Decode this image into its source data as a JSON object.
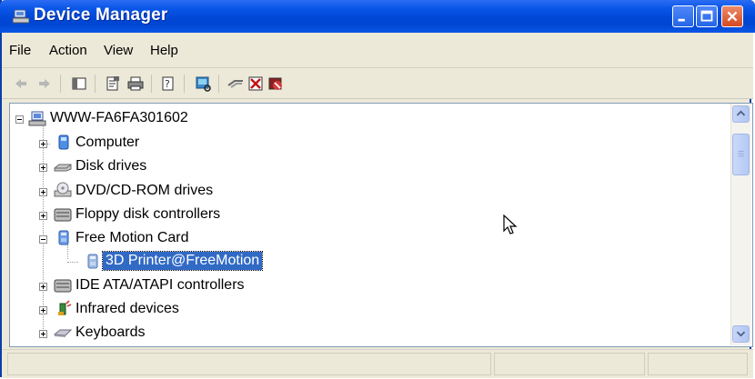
{
  "window": {
    "title": "Device Manager"
  },
  "menu": [
    "File",
    "Action",
    "View",
    "Help"
  ],
  "toolbar_icons": [
    "back-icon",
    "forward-icon",
    "console-tree-icon",
    "properties-icon",
    "print-icon",
    "help-icon",
    "scan-hardware-icon",
    "update-driver-icon",
    "uninstall-icon",
    "disable-icon"
  ],
  "tree": {
    "root": "WWW-FA6FA301602",
    "items": [
      {
        "label": "Computer",
        "icon": "computer-icon",
        "expanded": false
      },
      {
        "label": "Disk drives",
        "icon": "disk-drive-icon",
        "expanded": false
      },
      {
        "label": "DVD/CD-ROM drives",
        "icon": "dvd-drive-icon",
        "expanded": false
      },
      {
        "label": "Floppy disk controllers",
        "icon": "floppy-controller-icon",
        "expanded": false
      },
      {
        "label": "Free Motion Card",
        "icon": "device-icon",
        "expanded": true
      },
      {
        "label": "3D Printer@FreeMotion",
        "icon": "device-icon",
        "child": true,
        "selected": true
      },
      {
        "label": "IDE ATA/ATAPI controllers",
        "icon": "ide-controller-icon",
        "expanded": false
      },
      {
        "label": "Infrared devices",
        "icon": "infrared-icon",
        "expanded": false
      },
      {
        "label": "Keyboards",
        "icon": "keyboard-icon",
        "expanded": false
      }
    ]
  },
  "colors": {
    "title_gradient_top": "#2b6cf3",
    "title_gradient_bottom": "#0046d3",
    "selection": "#316ac5",
    "chrome": "#ece9d8"
  }
}
